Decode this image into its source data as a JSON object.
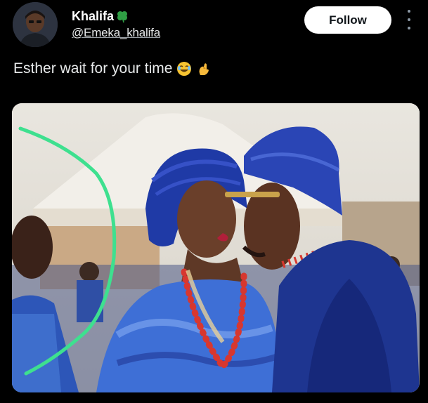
{
  "post": {
    "author": {
      "display_name": "Khalifa",
      "handle": "@Emeka_khalifa",
      "name_emoji": "four-leaf-clover-icon"
    },
    "follow_label": "Follow",
    "text": "Esther wait for your time",
    "text_emojis": [
      "laughing-face-icon",
      "pinching-hand-icon"
    ],
    "media": {
      "description_icon": "photo",
      "annotation_color": "#3ee08f"
    }
  },
  "colors": {
    "background": "#000000",
    "text": "#e7e9ea",
    "follow_bg": "#ffffff",
    "follow_text": "#0f1419",
    "gele_blue": "#1f3aa6",
    "coral_beads": "#d7372f"
  }
}
